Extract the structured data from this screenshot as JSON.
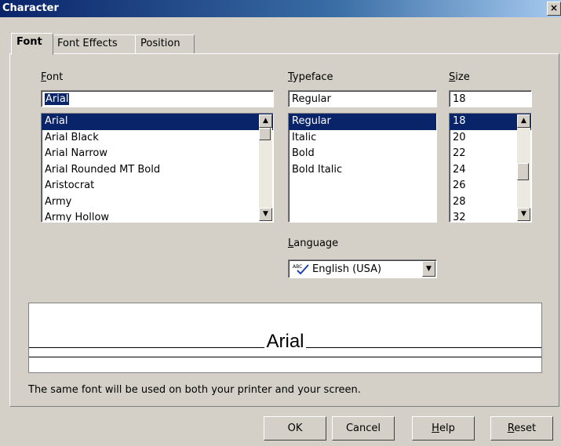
{
  "window": {
    "title": "Character",
    "close_label": "×"
  },
  "tabs": [
    {
      "label": "Font"
    },
    {
      "label": "Font Effects"
    },
    {
      "label": "Position"
    }
  ],
  "font": {
    "label": "Font",
    "value": "Arial",
    "items": [
      "Arial",
      "Arial Black",
      "Arial Narrow",
      "Arial Rounded MT Bold",
      "Aristocrat",
      "Army",
      "Army Hollow"
    ],
    "selected": "Arial"
  },
  "typeface": {
    "label": "Typeface",
    "value": "Regular",
    "items": [
      "Regular",
      "Italic",
      "Bold",
      "Bold Italic"
    ],
    "selected": "Regular"
  },
  "size": {
    "label": "Size",
    "value": "18",
    "items": [
      "18",
      "20",
      "22",
      "24",
      "26",
      "28",
      "32"
    ],
    "selected": "18"
  },
  "language": {
    "label": "Language",
    "value": "English (USA)",
    "icon": "spellcheck-icon"
  },
  "preview": {
    "text": "Arial"
  },
  "info": "The same font will be used on both your printer and your screen.",
  "buttons": {
    "ok": "OK",
    "cancel": "Cancel",
    "help": "Help",
    "reset": "Reset"
  }
}
